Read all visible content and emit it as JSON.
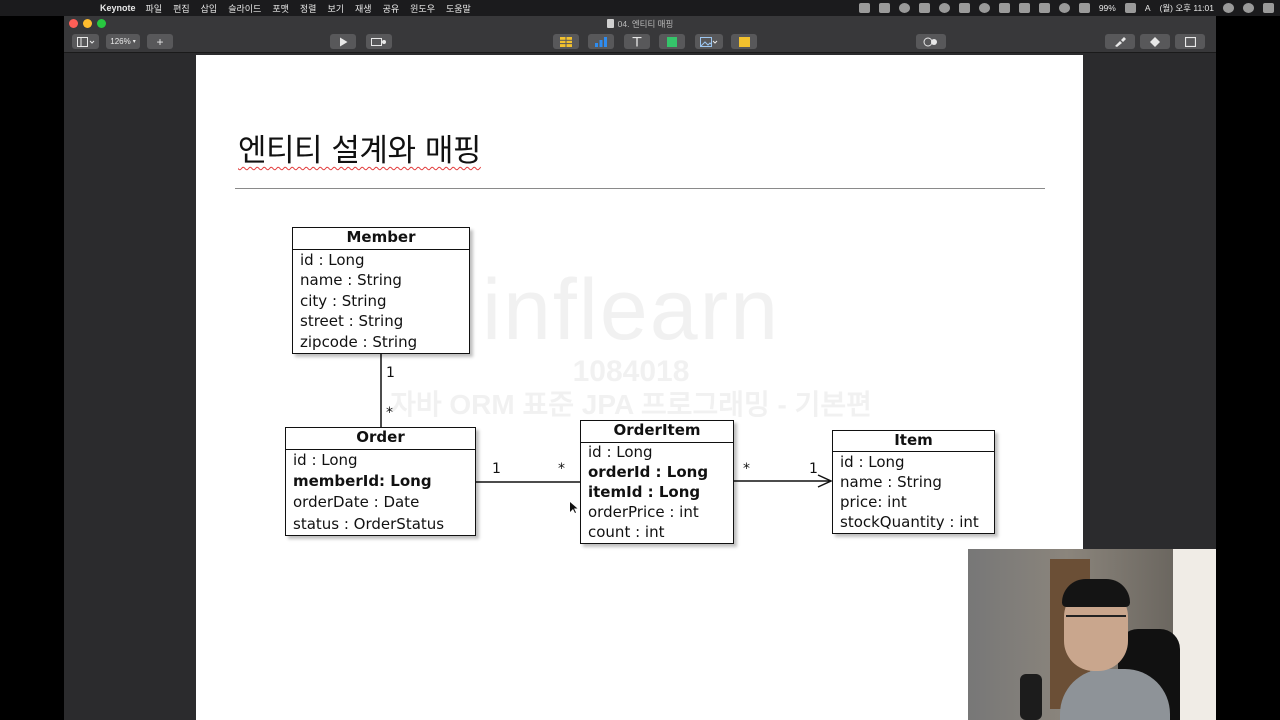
{
  "menubar": {
    "app": "Keynote",
    "menus": [
      "파일",
      "편집",
      "삽입",
      "슬라이드",
      "포맷",
      "정렬",
      "보기",
      "재생",
      "공유",
      "윈도우",
      "도움말"
    ],
    "battery": "99%",
    "input_source": "A",
    "clock": "(월) 오후 11:01"
  },
  "window": {
    "title": "04. 엔티티 매핑"
  },
  "toolbar": {
    "zoom": "126%",
    "add_symbol": "+"
  },
  "slide": {
    "title": "엔티티 설계와 매핑",
    "watermark": {
      "logo": "inflearn",
      "code": "1084018",
      "course": "자바 ORM 표준 JPA 프로그래밍 - 기본편"
    }
  },
  "uml": {
    "member": {
      "name": "Member",
      "attributes": [
        "id : Long",
        "name : String",
        "city : String",
        "street : String",
        "zipcode : String"
      ]
    },
    "order": {
      "name": "Order",
      "attributes": [
        "id : Long",
        "memberId: Long",
        "orderDate : Date",
        "status : OrderStatus"
      ]
    },
    "orderitem": {
      "name": "OrderItem",
      "attributes": [
        "id : Long",
        "orderId : Long",
        "itemId : Long",
        "orderPrice : int",
        "count : int"
      ]
    },
    "item": {
      "name": "Item",
      "attributes": [
        "id : Long",
        "name : String",
        "price: int",
        "stockQuantity : int"
      ]
    },
    "multiplicities": {
      "member_order_member_side": "1",
      "member_order_order_side": "*",
      "order_orderitem_order_side": "1",
      "order_orderitem_orderitem_side": "*",
      "orderitem_item_orderitem_side": "*",
      "orderitem_item_item_side": "1"
    }
  }
}
